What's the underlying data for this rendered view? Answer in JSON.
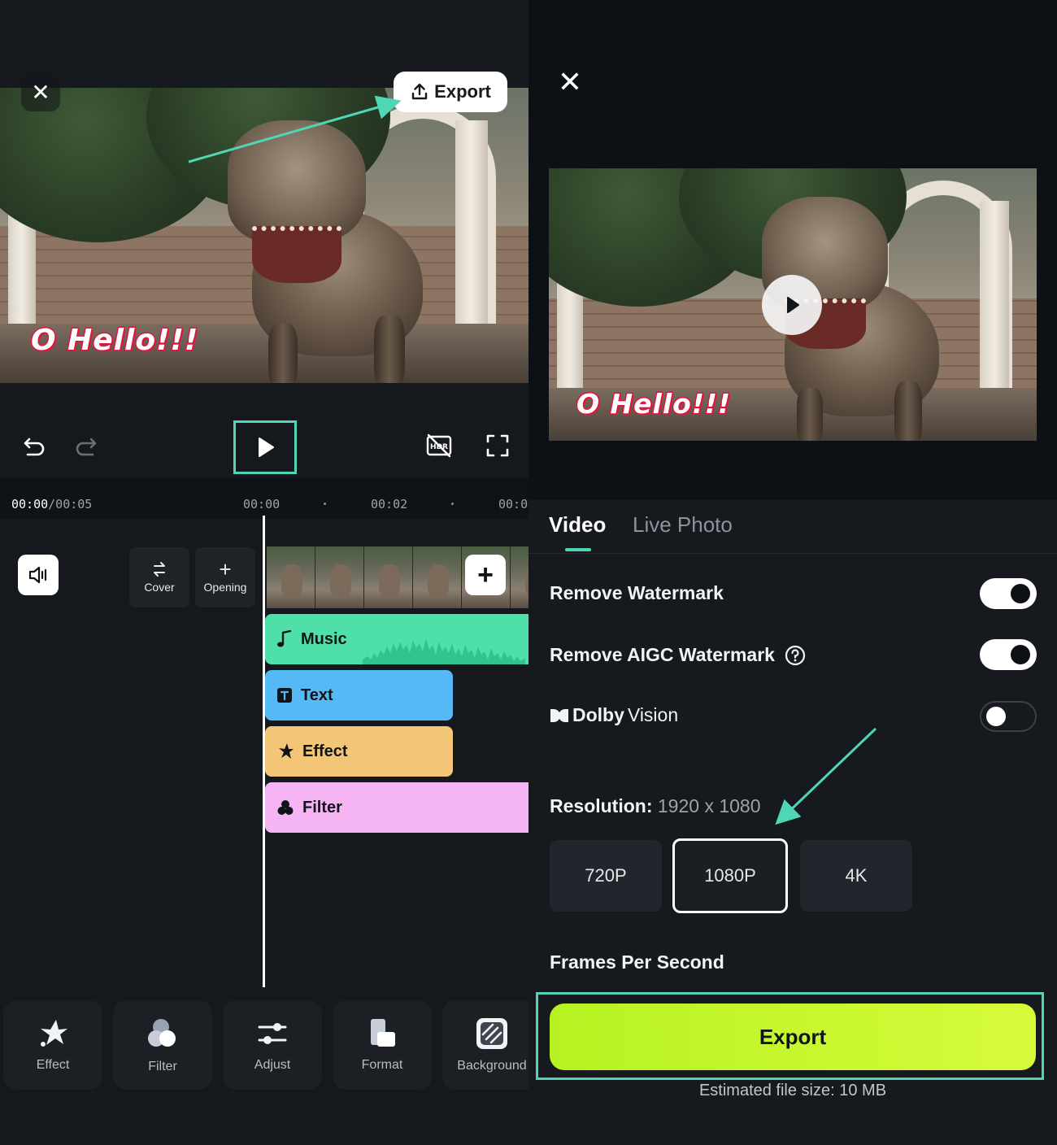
{
  "editor": {
    "export_label": "Export",
    "caption": "O Hello!!!",
    "time_current": "00:00",
    "time_total": "/00:05",
    "ticks": [
      "00:00",
      "00:02",
      "00:0"
    ],
    "side_buttons": [
      {
        "label": "Cover",
        "icon": "swap-arrows-icon"
      },
      {
        "label": "Opening",
        "icon": "plus-icon"
      }
    ],
    "tracks": [
      {
        "label": "Music",
        "color": "#4fe0aa",
        "icon": "music-note-icon"
      },
      {
        "label": "Text",
        "color": "#54b9f5",
        "icon": "text-icon"
      },
      {
        "label": "Effect",
        "color": "#f3c677",
        "icon": "sparkle-icon"
      },
      {
        "label": "Filter",
        "color": "#f5b4f4",
        "icon": "filter-icon"
      }
    ],
    "tools": [
      {
        "label": "Effect",
        "icon": "sparkle-star-icon"
      },
      {
        "label": "Filter",
        "icon": "filter-circles-icon"
      },
      {
        "label": "Adjust",
        "icon": "sliders-icon"
      },
      {
        "label": "Format",
        "icon": "format-icon"
      },
      {
        "label": "Background",
        "icon": "background-icon"
      }
    ],
    "accent": "#4fd6b5"
  },
  "export_sheet": {
    "caption": "O Hello!!!",
    "tabs": [
      "Video",
      "Live Photo"
    ],
    "active_tab": "Video",
    "remove_watermark": "Remove Watermark",
    "remove_watermark_on": true,
    "remove_aigc_watermark": "Remove AIGC Watermark",
    "remove_aigc_on": true,
    "dolby_brand": "Dolby",
    "dolby_suffix": "Vision",
    "dolby_on": false,
    "resolution_label": "Resolution:",
    "resolution_value": "1920 x 1080",
    "resolutions": [
      "720P",
      "1080P",
      "4K"
    ],
    "selected_resolution": "1080P",
    "fps_label": "Frames Per Second",
    "export_label": "Export",
    "estimate": "Estimated file size: 10 MB",
    "export_color": "#c4f52b"
  }
}
